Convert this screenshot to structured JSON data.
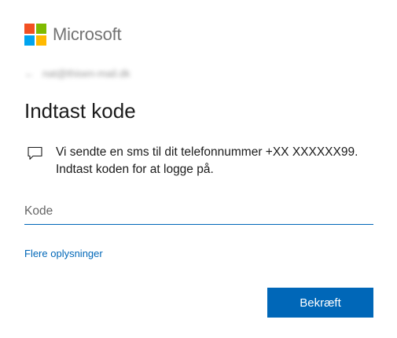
{
  "brand": {
    "name": "Microsoft",
    "logo_colors": [
      "#f25022",
      "#7fba00",
      "#00a4ef",
      "#ffb900"
    ]
  },
  "identity": {
    "back_icon": "back-arrow-icon",
    "email": "nat@thisen-mail.dk"
  },
  "page": {
    "title": "Indtast kode"
  },
  "message": {
    "icon": "speech-bubble-icon",
    "text": "Vi sendte en sms til dit telefonnummer +XX XXXXXX99. Indtast koden for at logge på."
  },
  "code_input": {
    "value": "",
    "placeholder": "Kode"
  },
  "links": {
    "more_info": "Flere oplysninger"
  },
  "actions": {
    "confirm_label": "Bekræft"
  },
  "colors": {
    "accent": "#0067b8",
    "text": "#1b1b1b"
  }
}
